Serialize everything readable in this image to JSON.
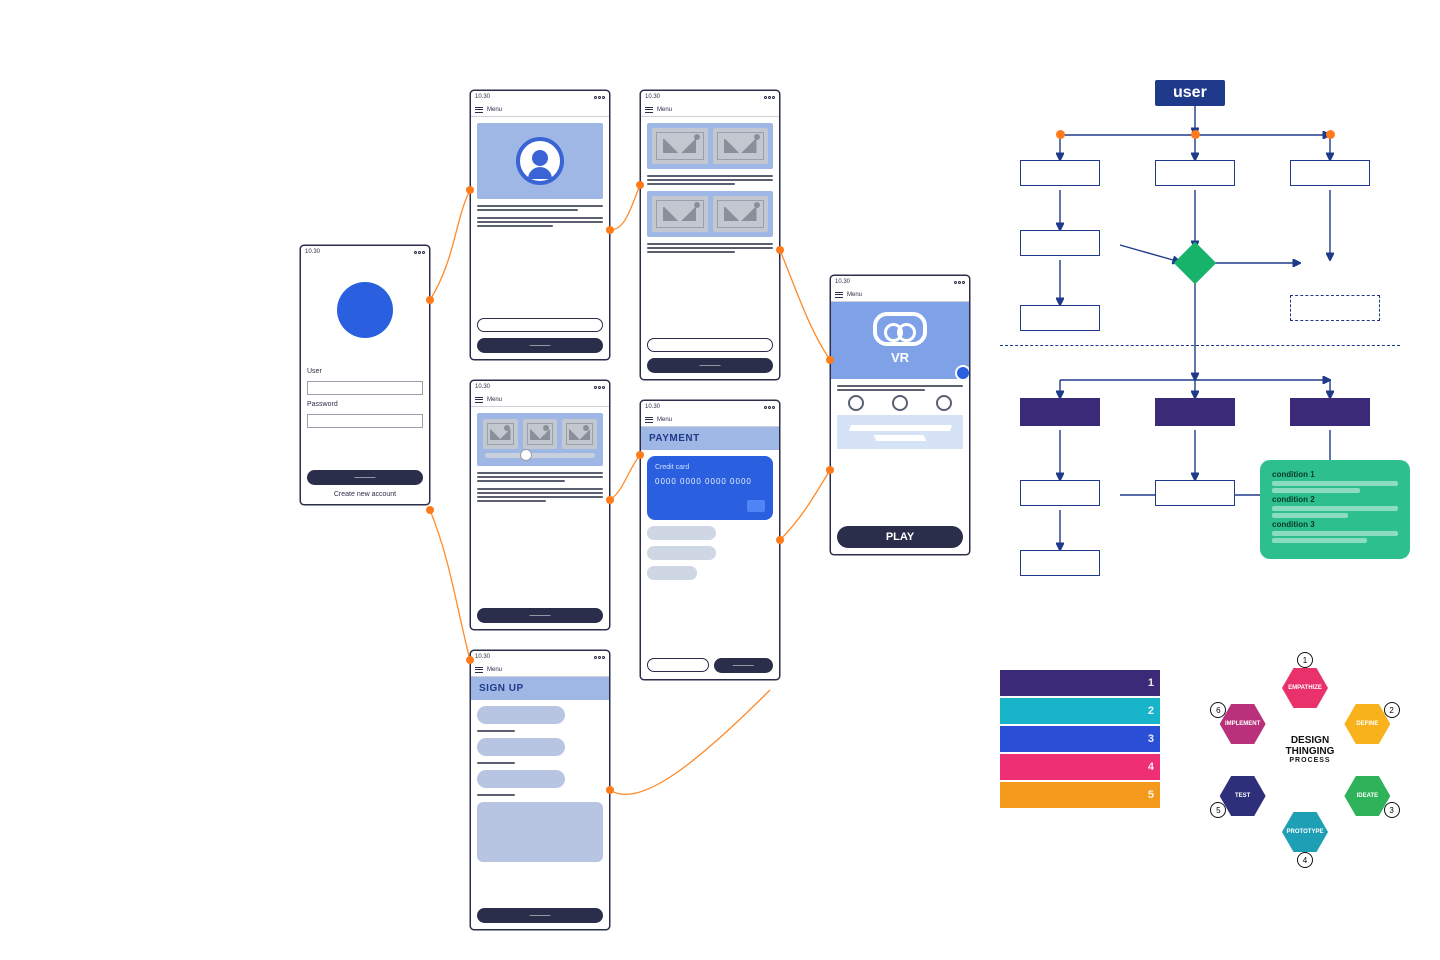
{
  "phones": {
    "common": {
      "time": "10.30",
      "menu_label": "Menu"
    },
    "login": {
      "user_label": "User",
      "password_label": "Password",
      "submit": "———",
      "create_account": "Create new account"
    },
    "profile": {
      "submit": "———"
    },
    "slider": {
      "submit": "———"
    },
    "grid4": {
      "submit": "———"
    },
    "signup": {
      "heading": "SIGN UP",
      "submit": "———"
    },
    "payment": {
      "heading": "PAYMENT",
      "card_label": "Credit card",
      "card_number": "0000 0000 0000 0000",
      "submit": "———"
    },
    "vr": {
      "title": "VR",
      "play": "PLAY"
    }
  },
  "flowchart": {
    "start_label": "user",
    "legend": {
      "title1": "condition 1",
      "title2": "condition 2",
      "title3": "condition 3"
    }
  },
  "palette": {
    "swatches": [
      {
        "color": "#3a2a78",
        "n": "1"
      },
      {
        "color": "#18b4c9",
        "n": "2"
      },
      {
        "color": "#2a4fd6",
        "n": "3"
      },
      {
        "color": "#ef2f74",
        "n": "4"
      },
      {
        "color": "#f39a1c",
        "n": "5"
      }
    ]
  },
  "design_thinking": {
    "center_line1": "DESIGN",
    "center_line2": "THINGING",
    "center_sub": "PROCESS",
    "steps": [
      {
        "label": "EMPATHIZE",
        "color": "#e9316b"
      },
      {
        "label": "DEFINE",
        "color": "#f7b21c"
      },
      {
        "label": "IDEATE",
        "color": "#2fb35a"
      },
      {
        "label": "PROTOTYPE",
        "color": "#1f9fb5"
      },
      {
        "label": "TEST",
        "color": "#2d2f7a"
      },
      {
        "label": "IMPLEMENT",
        "color": "#b8317a"
      }
    ]
  }
}
